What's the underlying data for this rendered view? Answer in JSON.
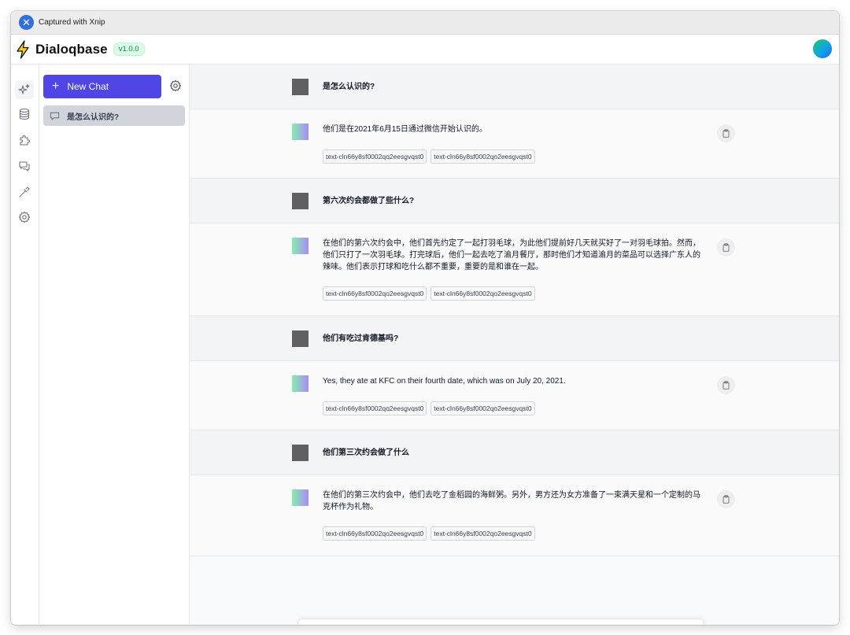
{
  "capture_bar": {
    "text": "Captured with Xnip",
    "logo_icon": "xnip-icon"
  },
  "header": {
    "brand": "Dialoqbase",
    "version": "v1.0.0",
    "logo_icon": "lightning-bolt-icon"
  },
  "rail_icons": [
    "sparkles-icon",
    "database-icon",
    "puzzle-icon",
    "chat-bubbles-icon",
    "dropper-icon",
    "cog-icon"
  ],
  "sidebar": {
    "new_chat_label": "New Chat",
    "history": [
      {
        "label": "是怎么认识的?",
        "icon": "chat-bubble-icon"
      }
    ]
  },
  "messages": [
    {
      "role": "user",
      "text": "是怎么认识的?"
    },
    {
      "role": "bot",
      "text": "他们是在2021年6月15日通过微信开始认识的。",
      "sources": [
        "text-cln66y8sf0002qo2eesgvqst0",
        "text-cln66y8sf0002qo2eesgvqst0"
      ]
    },
    {
      "role": "user",
      "text": "第六次约会都做了些什么?"
    },
    {
      "role": "bot",
      "text": "在他们的第六次约会中，他们首先约定了一起打羽毛球，为此他们提前好几天就买好了一对羽毛球拍。然而，他们只打了一次羽毛球。打完球后，他们一起去吃了渝月餐厅，那时他们才知道渝月的菜品可以选择广东人的辣味。他们表示打球和吃什么都不重要，重要的是和谁在一起。",
      "sources": [
        "text-cln66y8sf0002qo2eesgvqst0",
        "text-cln66y8sf0002qo2eesgvqst0"
      ]
    },
    {
      "role": "user",
      "text": "他们有吃过肯德基吗?"
    },
    {
      "role": "bot",
      "text": "Yes, they ate at KFC on their fourth date, which was on July 20, 2021.",
      "sources": [
        "text-cln66y8sf0002qo2eesgvqst0",
        "text-cln66y8sf0002qo2eesgvqst0"
      ]
    },
    {
      "role": "user",
      "text": "他们第三次约会做了什么"
    },
    {
      "role": "bot",
      "text": "在他们的第三次约会中，他们去吃了金稻园的海鲜粥。另外，男方还为女方准备了一束满天星和一个定制的马克杯作为礼物。",
      "sources": [
        "text-cln66y8sf0002qo2eesgvqst0",
        "text-cln66y8sf0002qo2eesgvqst0"
      ]
    }
  ]
}
